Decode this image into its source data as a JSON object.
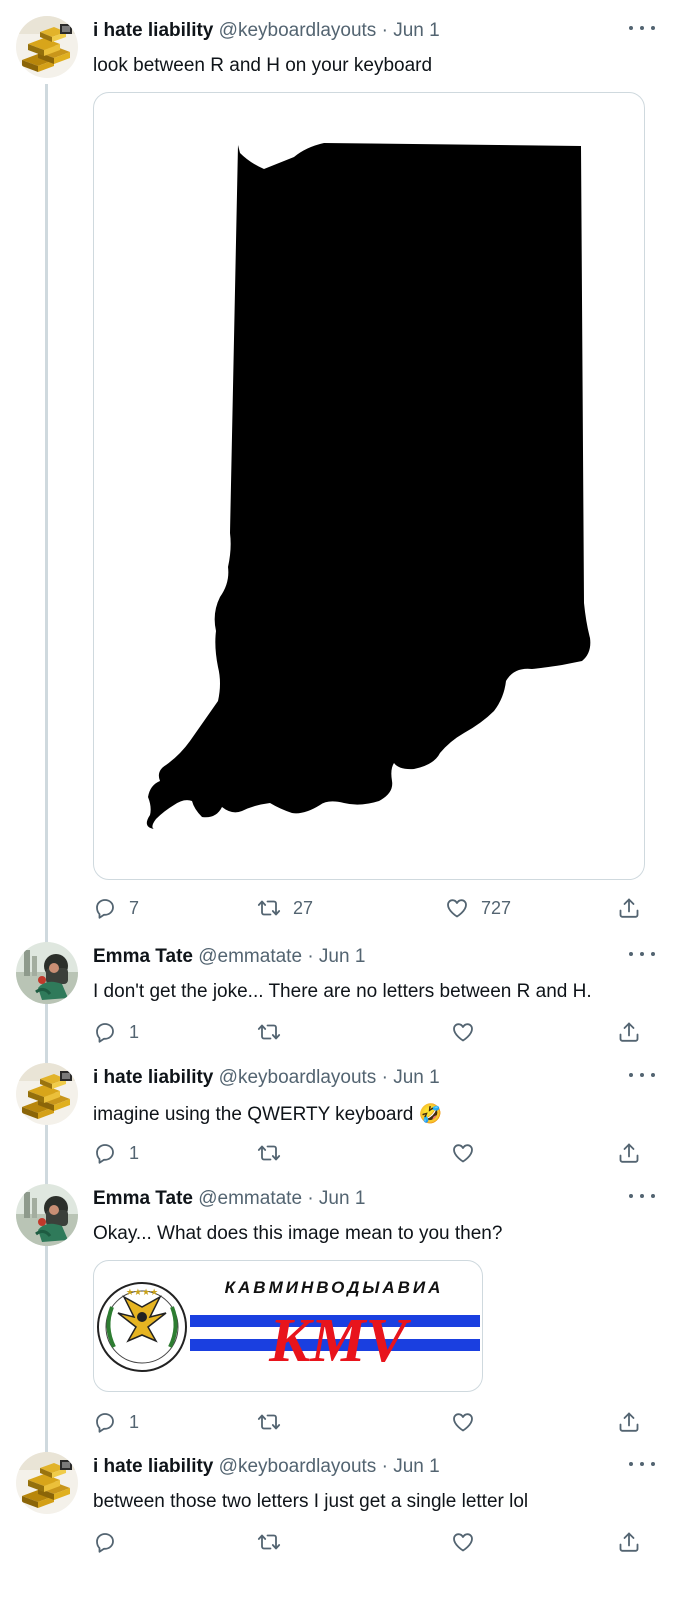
{
  "tweets": [
    {
      "name": "i hate liability",
      "handle": "@keyboardlayouts",
      "sep": "·",
      "date": "Jun 1",
      "text": "look between R and H on your keyboard",
      "replies": "7",
      "retweets": "27",
      "likes": "727"
    },
    {
      "name": "Emma Tate",
      "handle": "@emmatate",
      "sep": "·",
      "date": "Jun 1",
      "text": "I don't get the joke... There are no letters between R and H.",
      "replies": "1",
      "retweets": "",
      "likes": ""
    },
    {
      "name": "i hate liability",
      "handle": "@keyboardlayouts",
      "sep": "·",
      "date": "Jun 1",
      "text": "imagine using the QWERTY keyboard",
      "emoji": "🤣",
      "replies": "1",
      "retweets": "",
      "likes": ""
    },
    {
      "name": "Emma Tate",
      "handle": "@emmatate",
      "sep": "·",
      "date": "Jun 1",
      "text": "Okay... What does this image mean to you then?",
      "replies": "1",
      "retweets": "",
      "likes": "",
      "logo": {
        "top_text": "КАВМИНВОДЫАВИА",
        "main_text": "KMV"
      }
    },
    {
      "name": "i hate liability",
      "handle": "@keyboardlayouts",
      "sep": "·",
      "date": "Jun 1",
      "text": "between those two letters I just get a single letter lol",
      "replies": "",
      "retweets": "",
      "likes": ""
    }
  ],
  "colors": {
    "text": "#0f1419",
    "secondary": "#536471",
    "thread_line": "#cfd9de",
    "logo_red": "#e8141c",
    "logo_blue": "#1a3fe0"
  },
  "icons": {
    "reply": "reply-icon",
    "retweet": "retweet-icon",
    "like": "like-icon",
    "share": "share-icon",
    "more": "more-icon"
  }
}
